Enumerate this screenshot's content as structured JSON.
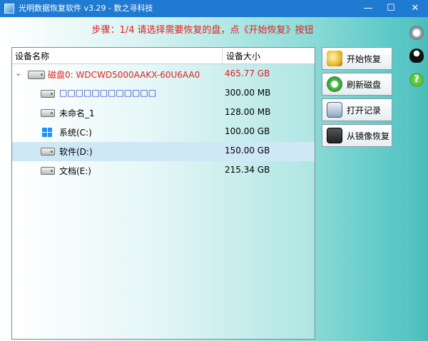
{
  "window": {
    "title": "光明数据恢复软件 v3.29 - 数之寻科技",
    "minimize": "—",
    "maximize": "☐",
    "close": "✕"
  },
  "step_instruction": "步骤：1/4 请选择需要恢复的盘，点《开始恢复》按钮",
  "device_list": {
    "columns": [
      "设备名称",
      "设备大小"
    ],
    "rows": [
      {
        "name": "磁盘0: WDCWD5000AAKX-60U6AA0",
        "size": "465.77 GB",
        "level": 0,
        "icon": "hdd-icon",
        "color": "#e02020",
        "expanded": true
      },
      {
        "name": "□□□□□□□□□□□□",
        "size": "300.00 MB",
        "level": 1,
        "icon": "hdd-icon",
        "color": "#1a2fbf"
      },
      {
        "name": "未命名_1",
        "size": "128.00 MB",
        "level": 1,
        "icon": "hdd-icon",
        "color": "#000000"
      },
      {
        "name": "系统(C:)",
        "size": "100.00 GB",
        "level": 1,
        "icon": "windows-icon",
        "color": "#000000"
      },
      {
        "name": "软件(D:)",
        "size": "150.00 GB",
        "level": 1,
        "icon": "hdd-icon",
        "color": "#000000",
        "selected": true
      },
      {
        "name": "文档(E:)",
        "size": "215.34 GB",
        "level": 1,
        "icon": "hdd-icon",
        "color": "#000000"
      }
    ]
  },
  "actions": [
    {
      "label": "开始恢复",
      "icon": "magnifier-icon"
    },
    {
      "label": "刷新磁盘",
      "icon": "refresh-icon"
    },
    {
      "label": "打开记录",
      "icon": "log-icon"
    },
    {
      "label": "从镜像恢复",
      "icon": "disk-image-icon"
    }
  ],
  "sidebar": {
    "help_glyph": "?"
  },
  "colors": {
    "titlebar": "#1f7bd2",
    "accent_red": "#e02020",
    "selection": "#cfe8f6"
  }
}
